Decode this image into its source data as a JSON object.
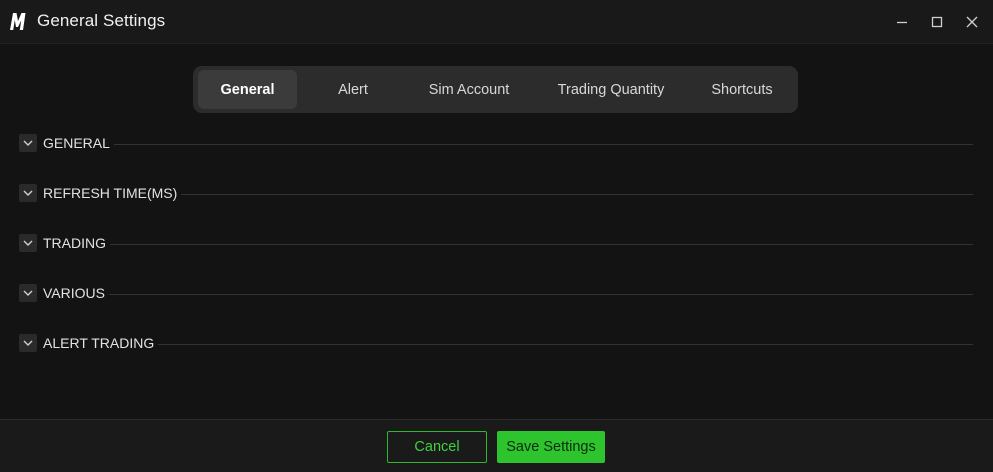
{
  "window": {
    "title": "General Settings",
    "logo_icon": "brand-m-logo",
    "controls": [
      "minimize-icon",
      "maximize-icon",
      "close-icon"
    ]
  },
  "tabs": [
    {
      "label": "General",
      "active": true
    },
    {
      "label": "Alert",
      "active": false
    },
    {
      "label": "Sim Account",
      "active": false
    },
    {
      "label": "Trading Quantity",
      "active": false
    },
    {
      "label": "Shortcuts",
      "active": false
    }
  ],
  "sections": [
    {
      "label": "GENERAL",
      "expanded": false
    },
    {
      "label": "REFRESH TIME(MS)",
      "expanded": false
    },
    {
      "label": "TRADING",
      "expanded": false
    },
    {
      "label": "VARIOUS",
      "expanded": false
    },
    {
      "label": "ALERT TRADING",
      "expanded": false
    }
  ],
  "footer": {
    "cancel_label": "Cancel",
    "save_label": "Save Settings"
  },
  "colors": {
    "background": "#131313",
    "accent_green": "#2ec42e",
    "tab_bar": "#2c2c2c",
    "active_tab": "#3b3b3b"
  }
}
